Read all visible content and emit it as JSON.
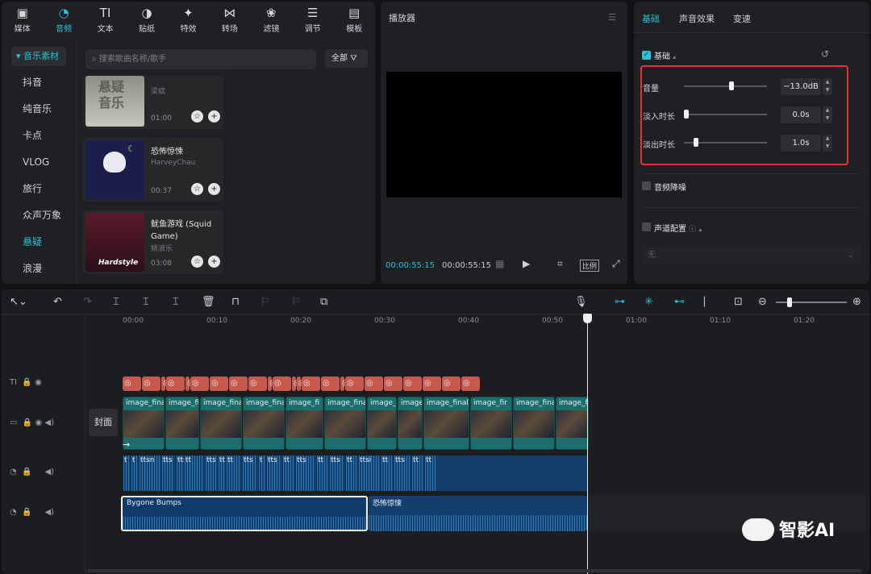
{
  "media_tabs": [
    {
      "label": "媒体",
      "icon": "media-icon"
    },
    {
      "label": "音频",
      "icon": "audio-icon",
      "active": true
    },
    {
      "label": "文本",
      "icon": "text-icon"
    },
    {
      "label": "贴纸",
      "icon": "sticker-icon"
    },
    {
      "label": "特效",
      "icon": "effects-icon"
    },
    {
      "label": "转场",
      "icon": "transition-icon"
    },
    {
      "label": "滤镜",
      "icon": "filter-icon"
    },
    {
      "label": "调节",
      "icon": "adjust-icon"
    },
    {
      "label": "模板",
      "icon": "template-icon"
    }
  ],
  "sidebar": {
    "header": "音乐素材",
    "items": [
      "抖音",
      "纯音乐",
      "卡点",
      "VLOG",
      "旅行",
      "众声万象",
      "悬疑",
      "浪漫"
    ],
    "active": "悬疑"
  },
  "search": {
    "placeholder": "搜索歌曲名称/歌手",
    "filter_label": "全部"
  },
  "music_cards": [
    {
      "title": "",
      "thumb_text": "悬疑\n音乐",
      "artist": "梁斌",
      "duration": "01:00"
    },
    {
      "title": "恐怖惊悚",
      "artist": "HarveyChau",
      "duration": "00:37"
    },
    {
      "title": "鱿鱼游戏 (Squid Game)",
      "thumb_text": "Hardstyle",
      "artist": "姚浪乐",
      "duration": "03:08"
    }
  ],
  "player": {
    "title": "播放器",
    "current_time": "00:00:55:15",
    "total_time": "00:00:55:15",
    "ratio_label": "比例"
  },
  "props": {
    "tabs": [
      "基础",
      "声音效果",
      "变速"
    ],
    "basic_section": "基础",
    "volume_label": "音量",
    "volume_value": "−13.0dB",
    "fade_in_label": "淡入时长",
    "fade_in_value": "0.0s",
    "fade_out_label": "淡出时长",
    "fade_out_value": "1.0s",
    "denoise_label": "音频降噪",
    "channel_label": "声道配置",
    "channel_value": "无",
    "volume_level": 0.58,
    "fade_in_level": 0.0,
    "fade_out_level": 0.12
  },
  "timeline": {
    "ruler": [
      "00:00",
      "00:10",
      "00:20",
      "00:30",
      "00:40",
      "00:50",
      "01:00",
      "01:10",
      "01:20"
    ],
    "cover_label": "封面",
    "video_clip_names": [
      "image_final",
      "image_fir",
      "image_fina",
      "image_final",
      "image_fi",
      "image_final",
      "image_",
      "image_",
      "image_final_5",
      "image_fir",
      "image_final",
      "image_fir"
    ],
    "tts_labels": [
      "t",
      "t",
      "ttsn",
      "tts",
      "tts",
      "tt",
      "tts",
      "tt",
      "tt",
      "tts",
      "t",
      "tts",
      "tt",
      "tts",
      "tt",
      "tts",
      "tt",
      "ttsi",
      "tt",
      "tts",
      "tt",
      "tt"
    ],
    "audio_clips": [
      "Bygone Bumps",
      "恐怖惊悚"
    ]
  },
  "watermark": "智影AI",
  "colors": {
    "accent": "#27c2d8",
    "text_track": "#c75a4d",
    "video_track": "#1b6e6c",
    "audio_track": "#0f3b6b",
    "highlight_box": "#e53239"
  }
}
